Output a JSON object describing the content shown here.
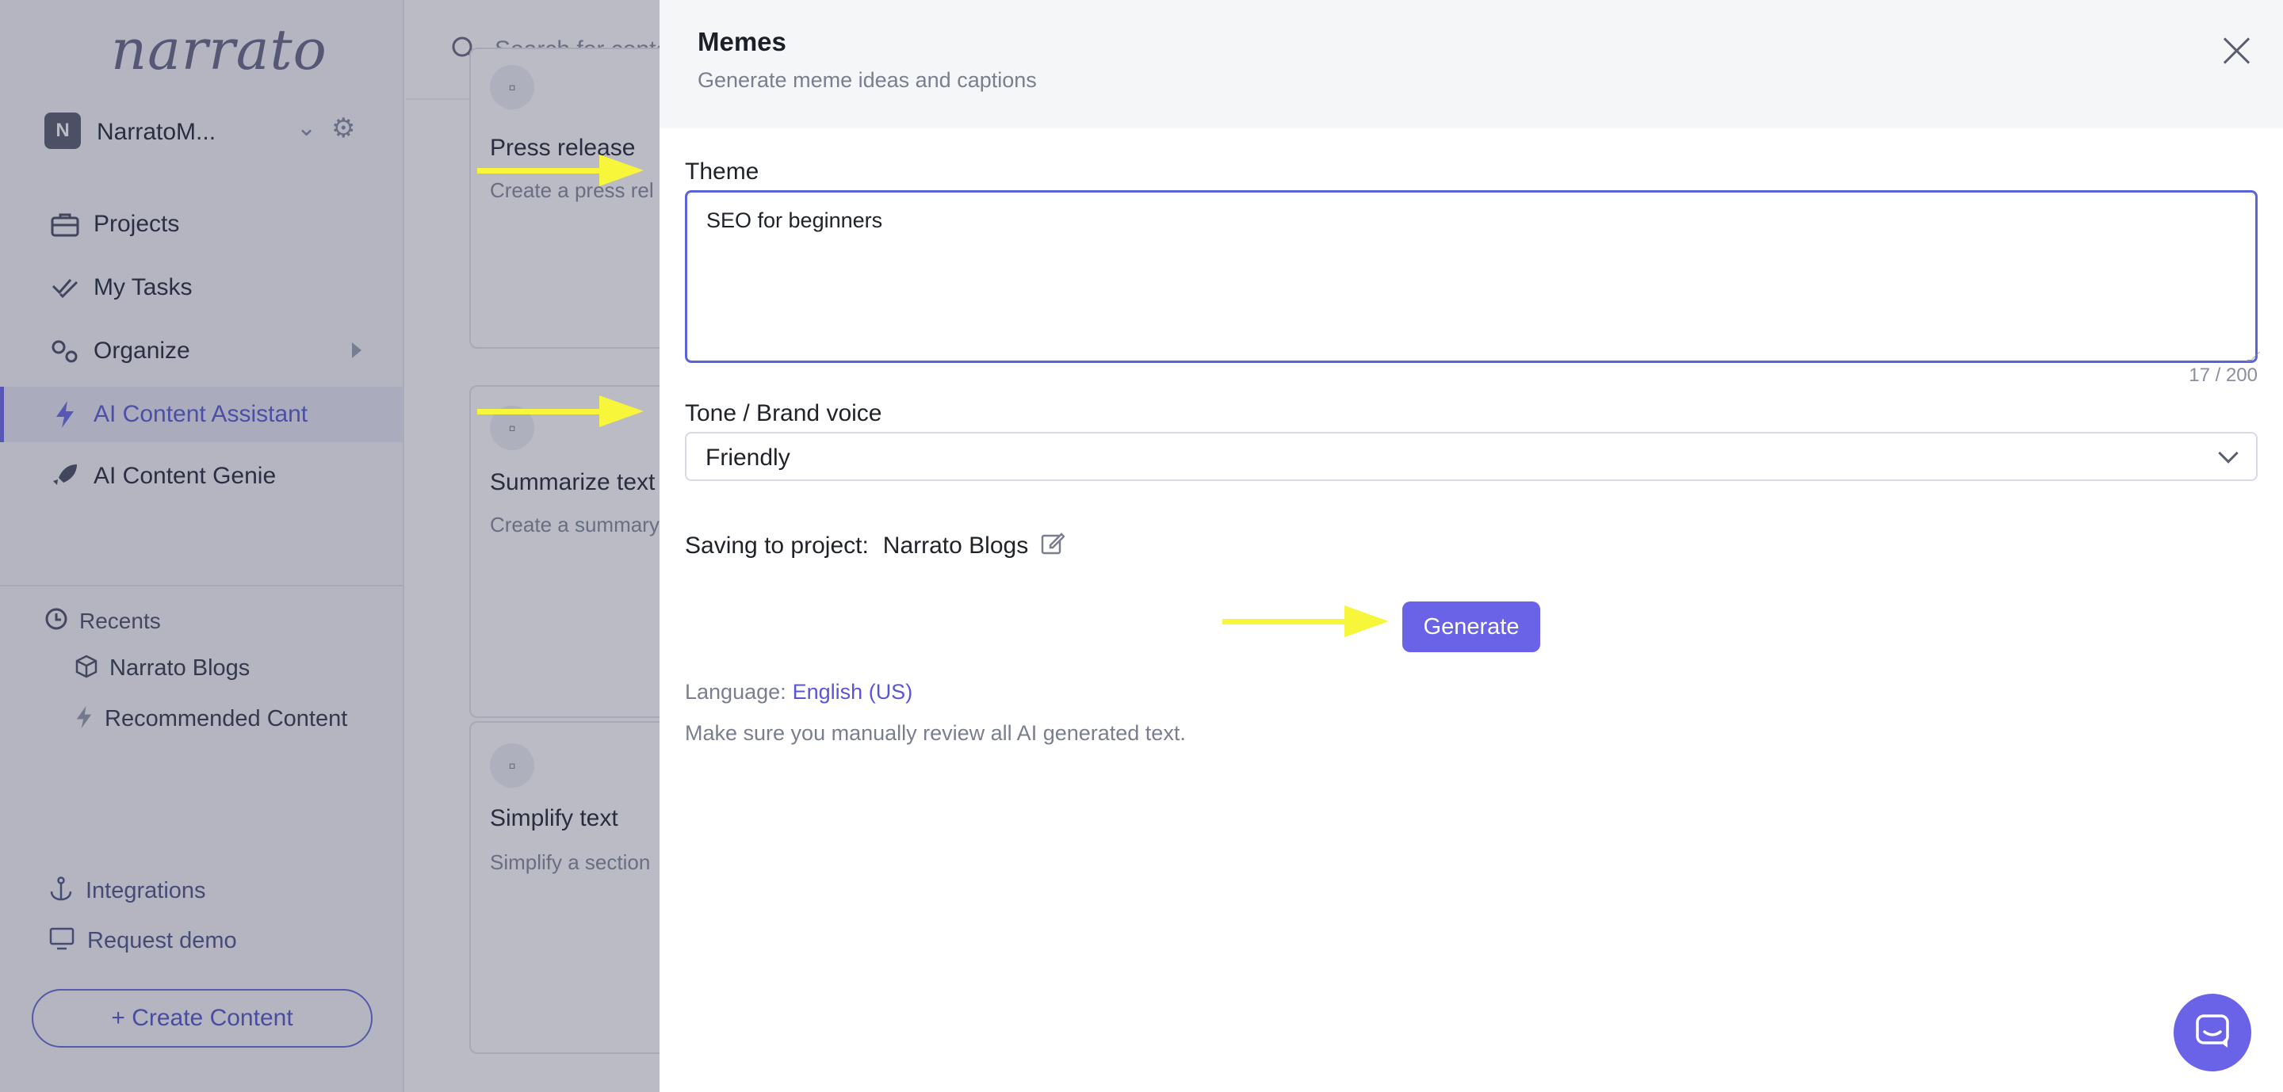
{
  "sidebar": {
    "logo": "narrato",
    "workspace": {
      "initial": "N",
      "name": "NarratoM..."
    },
    "nav": [
      {
        "label": "Projects",
        "icon": "briefcase-icon"
      },
      {
        "label": "My Tasks",
        "icon": "check-icon"
      },
      {
        "label": "Organize",
        "icon": "gears-icon"
      },
      {
        "label": "AI Content Assistant",
        "icon": "lightning-icon",
        "active": true
      },
      {
        "label": "AI Content Genie",
        "icon": "rocket-icon"
      }
    ],
    "recents": {
      "heading": "Recents",
      "items": [
        {
          "label": "Narrato Blogs",
          "icon": "cube-icon"
        },
        {
          "label": "Recommended Content",
          "icon": "lightning-icon"
        }
      ]
    },
    "footer": [
      {
        "label": "Integrations",
        "icon": "anchor-icon"
      },
      {
        "label": "Request demo",
        "icon": "monitor-icon"
      }
    ],
    "create_button": "+ Create Content"
  },
  "content": {
    "search_placeholder": "Search for conte",
    "cards": [
      {
        "title": "Press release",
        "desc": "Create a press rel"
      },
      {
        "title": "Summarize text",
        "desc": "Create a summary text"
      },
      {
        "title": "Simplify text",
        "desc": "Simplify a section"
      }
    ]
  },
  "panel": {
    "title": "Memes",
    "subtitle": "Generate meme ideas and captions",
    "theme_label": "Theme",
    "theme_value": "SEO for beginners",
    "char_count": "17 / 200",
    "tone_label": "Tone / Brand voice",
    "tone_value": "Friendly",
    "saving_label": "Saving to project:",
    "saving_project": "Narrato Blogs",
    "generate_button": "Generate",
    "language_label": "Language:",
    "language_value": "English (US)",
    "disclaimer": "Make sure you manually review all AI generated text."
  },
  "colors": {
    "accent": "#6a63e8",
    "highlight_arrow": "#f7f63a",
    "overlay": "#282c46"
  }
}
